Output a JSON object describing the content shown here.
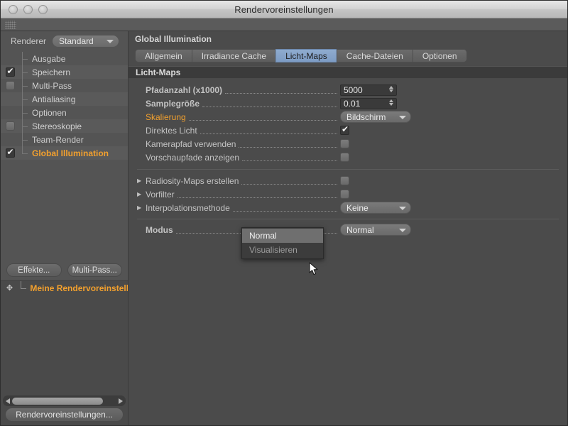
{
  "window": {
    "title": "Rendervoreinstellungen",
    "traffic_lights": [
      "close",
      "minimize",
      "zoom"
    ]
  },
  "left_panel": {
    "renderer_label": "Renderer",
    "renderer_value": "Standard",
    "tree_items": [
      {
        "label": "Ausgabe",
        "checkbox": "none",
        "selected": false
      },
      {
        "label": "Speichern",
        "checkbox": "checked",
        "selected": false
      },
      {
        "label": "Multi-Pass",
        "checkbox": "unchecked",
        "selected": false
      },
      {
        "label": "Antialiasing",
        "checkbox": "none",
        "selected": false
      },
      {
        "label": "Optionen",
        "checkbox": "none",
        "selected": false
      },
      {
        "label": "Stereoskopie",
        "checkbox": "unchecked",
        "selected": false
      },
      {
        "label": "Team-Render",
        "checkbox": "none",
        "selected": false
      },
      {
        "label": "Global Illumination",
        "checkbox": "checked",
        "selected": true
      }
    ],
    "buttons": {
      "effects": "Effekte...",
      "multipass": "Multi-Pass..."
    },
    "preset_row_label": "Meine Rendervoreinstellun",
    "bottom_button": "Rendervoreinstellungen..."
  },
  "right_panel": {
    "section_title": "Global Illumination",
    "tabs": [
      {
        "label": "Allgemein",
        "active": false
      },
      {
        "label": "Irradiance Cache",
        "active": false
      },
      {
        "label": "Licht-Maps",
        "active": true
      },
      {
        "label": "Cache-Dateien",
        "active": false
      },
      {
        "label": "Optionen",
        "active": false
      }
    ],
    "subheader": "Licht-Maps",
    "settings": [
      {
        "label": "Pfadanzahl (x1000)",
        "type": "number",
        "value": "5000",
        "highlight": false,
        "expander": false,
        "bold": true
      },
      {
        "label": "Samplegröße",
        "type": "number",
        "value": "0.01",
        "highlight": false,
        "expander": false,
        "bold": true
      },
      {
        "label": "Skalierung",
        "type": "select",
        "value": "Bildschirm",
        "highlight": true,
        "expander": false,
        "bold": false
      },
      {
        "label": "Direktes Licht",
        "type": "checkbox",
        "value": "checked",
        "highlight": false,
        "expander": false,
        "bold": false
      },
      {
        "label": "Kamerapfad verwenden",
        "type": "checkbox",
        "value": "unchecked",
        "highlight": false,
        "expander": false,
        "bold": false
      },
      {
        "label": "Vorschaupfade anzeigen",
        "type": "checkbox",
        "value": "unchecked",
        "highlight": false,
        "expander": false,
        "bold": false
      }
    ],
    "settings2": [
      {
        "label": "Radiosity-Maps erstellen",
        "type": "checkbox",
        "value": "unchecked",
        "expander": true,
        "bold": false
      },
      {
        "label": "Vorfilter",
        "type": "checkbox",
        "value": "unchecked",
        "expander": true,
        "bold": false
      },
      {
        "label": "Interpolationsmethode",
        "type": "select",
        "value": "Keine",
        "expander": true,
        "bold": false
      }
    ],
    "mode_row": {
      "label": "Modus",
      "value": "Normal",
      "bold": true
    },
    "dropdown_open": {
      "options": [
        {
          "label": "Normal",
          "highlighted": true
        },
        {
          "label": "Visualisieren",
          "highlighted": false
        }
      ]
    }
  },
  "colors": {
    "accent_orange": "#f2a02e",
    "tab_active_blue": "#7d9cc4",
    "panel_bg": "#4b4b4b",
    "sidebar_bg": "#545454",
    "field_bg": "#3a3a3a"
  }
}
